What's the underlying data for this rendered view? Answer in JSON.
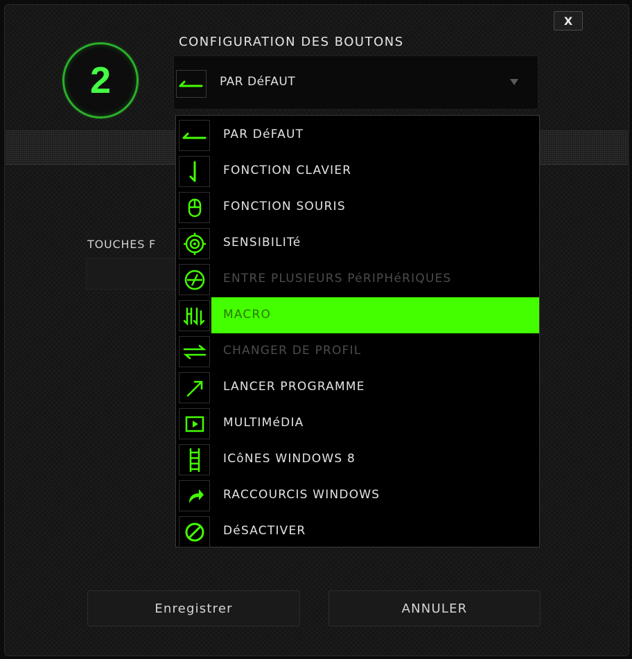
{
  "dialog": {
    "close_label": "X",
    "button_number": "2",
    "section_title": "CONFIGURATION DES BOUTONS",
    "accent_color": "#44ff00"
  },
  "dropdown": {
    "selected_label": "PAR DéFAUT",
    "selected_icon": "arrow-left-icon",
    "options": [
      {
        "label": "PAR DéFAUT",
        "icon": "arrow-left-icon",
        "state": "normal"
      },
      {
        "label": "FONCTION CLAVIER",
        "icon": "key-down-icon",
        "state": "normal"
      },
      {
        "label": "FONCTION SOURIS",
        "icon": "mouse-icon",
        "state": "normal"
      },
      {
        "label": "SENSIBILITé",
        "icon": "target-icon",
        "state": "normal"
      },
      {
        "label": "ENTRE PLUSIEURS PéRIPHéRIQUES",
        "icon": "inter-device-icon",
        "state": "disabled"
      },
      {
        "label": "MACRO",
        "icon": "macro-icon",
        "state": "selected"
      },
      {
        "label": "CHANGER DE PROFIL",
        "icon": "switch-profile-icon",
        "state": "disabled"
      },
      {
        "label": "LANCER PROGRAMME",
        "icon": "launch-icon",
        "state": "normal"
      },
      {
        "label": "MULTIMéDIA",
        "icon": "play-icon",
        "state": "normal"
      },
      {
        "label": "ICôNES WINDOWS 8",
        "icon": "windows8-icon",
        "state": "normal"
      },
      {
        "label": "RACCOURCIS WINDOWS",
        "icon": "shortcut-icon",
        "state": "normal"
      },
      {
        "label": "DéSACTIVER",
        "icon": "disable-icon",
        "state": "normal"
      }
    ]
  },
  "background": {
    "partial_label": "TOUCHES F"
  },
  "footer": {
    "save_label": "Enregistrer",
    "cancel_label": "ANNULER"
  }
}
